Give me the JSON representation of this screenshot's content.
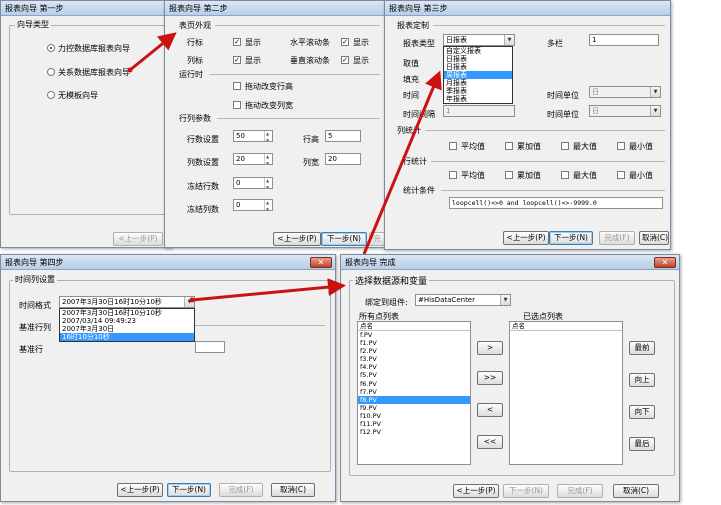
{
  "w1": {
    "title": "报表向导 第一步",
    "group": "向导类型",
    "options": [
      "力控数据库报表向导",
      "关系数据库报表向导",
      "无模板向导"
    ],
    "btn_prev": "<上一步(P)"
  },
  "w2": {
    "title": "报表向导 第二步",
    "sec_appearance": "表页外观",
    "row_label": "行标",
    "row_show": "显示",
    "hscroll": "水平滚动条",
    "hscroll_show": "显示",
    "col_label": "列标",
    "col_show": "显示",
    "vscroll": "垂直滚动条",
    "vscroll_show": "显示",
    "sec_runtime": "运行时",
    "drag_row_h": "拖动改变行高",
    "drag_col_w": "拖动改变列宽",
    "sec_rowcol": "行列参数",
    "row_count_label": "行数设置",
    "row_count": "50",
    "row_h_label": "行高",
    "row_h": "5",
    "col_count_label": "列数设置",
    "col_count": "20",
    "col_w_label": "列宽",
    "col_w": "20",
    "freeze_rows_label": "冻结行数",
    "freeze_rows": "0",
    "freeze_cols_label": "冻结列数",
    "freeze_cols": "0",
    "btn_prev": "<上一步(P)",
    "btn_next": "下一步(N)",
    "btn_finish": "完"
  },
  "w3": {
    "title": "报表向导 第三步",
    "sec_custom": "报表定制",
    "type_label": "报表类型",
    "type_value": "日报表",
    "multi_label": "多栏",
    "multi_value": "1",
    "value_label": "取值",
    "fill_label": "填充",
    "time_label": "时间",
    "time_unit_label": "时间单位",
    "time_unit_value": "日",
    "time_interval_label": "时间间隔",
    "time_interval_value": "1",
    "time_unit2_label": "时间单位",
    "time_unit2_value": "日",
    "type_options": [
      "自定义报表",
      "日报表",
      "日报表",
      "周报表",
      "月报表",
      "季报表",
      "年报表"
    ],
    "type_selected_index": 3,
    "sec_col_stats": "列统计",
    "sec_row_stats": "行统计",
    "stats": [
      "平均值",
      "累加值",
      "最大值",
      "最小值"
    ],
    "cond_label": "统计条件",
    "cond_value": "loopcell()<>0 and loopcell()<>-9999.0",
    "btn_prev": "<上一步(P)",
    "btn_next": "下一步(N)",
    "btn_finish": "完成(F)",
    "btn_cancel": "取消(C)"
  },
  "w4": {
    "title": "报表向导 第四步",
    "sec_time": "时间列设置",
    "fmt_label": "时间格式",
    "fmt_value": "2007年3月30日16时10分10秒",
    "base_col_label": "基准行列",
    "base_row_label": "基准行",
    "fmt_options": [
      "2007年3月30日16时10分10秒",
      "2007/03/14 09:49:23",
      "2007年3月30日",
      "16时10分10秒"
    ],
    "fmt_selected_index": 3,
    "btn_prev": "<上一步(P)",
    "btn_next": "下一步(N)",
    "btn_finish": "完成(F)",
    "btn_cancel": "取消(C)"
  },
  "w5": {
    "title": "报表向导 完成",
    "sec_select": "选择数据源和变量",
    "bind_label": "绑定到组件:",
    "bind_value": "#HisDataCenter",
    "all_label": "所有点列表",
    "chosen_label": "已选点列表",
    "col_header": "点名",
    "col_header2": "点名",
    "points": [
      "f.PV",
      "f1.PV",
      "f2.PV",
      "f3.PV",
      "f4.PV",
      "f5.PV",
      "f6.PV",
      "f7.PV",
      "f8.PV",
      "f9.PV",
      "f10.PV",
      "f11.PV",
      "f12.PV"
    ],
    "selected_point_index": 8,
    "btn_add": ">",
    "btn_add_all": ">>",
    "btn_remove": "<",
    "btn_remove_all": "<<",
    "btn_top": "最前",
    "btn_up": "向上",
    "btn_down": "向下",
    "btn_bottom": "最后",
    "btn_prev": "<上一步(P)",
    "btn_next": "下一步(N)",
    "btn_finish": "完成(F)",
    "btn_cancel": "取消(C)"
  },
  "colors": {
    "accent_arrow": "#cc1111",
    "select_blue": "#3399ff"
  }
}
